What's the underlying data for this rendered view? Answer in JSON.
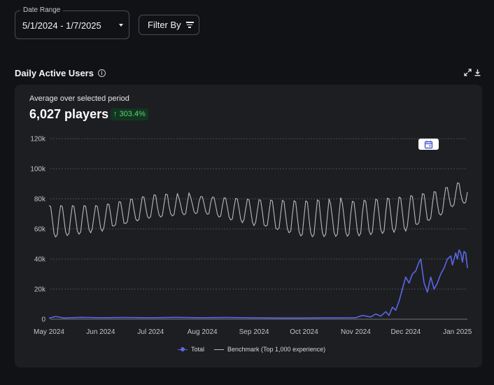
{
  "controls": {
    "date_range_label": "Date Range",
    "date_range_value": "5/1/2024 - 1/7/2025",
    "filter_label": "Filter By"
  },
  "section": {
    "title": "Daily Active Users",
    "info_glyph": "i"
  },
  "summary": {
    "label": "Average over selected period",
    "value": "6,027 players",
    "delta": "↑ 303.4%",
    "delta_color": "#5fd07a"
  },
  "icons": [
    "expand-icon",
    "download-icon",
    "info-icon",
    "calendar-icon",
    "filter-icon",
    "chevron-down-icon"
  ],
  "chart_data": {
    "type": "line",
    "x_tick_labels": [
      "May 2024",
      "Jun 2024",
      "Jul 2024",
      "Aug 2024",
      "Sep 2024",
      "Oct 2024",
      "Nov 2024",
      "Dec 2024",
      "Jan 2025"
    ],
    "x_range": [
      "2024-05-01",
      "2025-01-07"
    ],
    "ylim": [
      0,
      120000
    ],
    "y_ticks": [
      0,
      20000,
      40000,
      60000,
      80000,
      100000,
      120000
    ],
    "y_tick_labels": [
      "0",
      "20k",
      "40k",
      "60k",
      "80k",
      "100k",
      "120k"
    ],
    "grid": "horizontal dashed",
    "legend_position": "bottom-center",
    "series": [
      {
        "name": "Total",
        "color": "#5b67e8",
        "points": [
          [
            "2024-05-01",
            600
          ],
          [
            "2024-05-05",
            1800
          ],
          [
            "2024-05-10",
            800
          ],
          [
            "2024-05-20",
            1200
          ],
          [
            "2024-06-01",
            1000
          ],
          [
            "2024-06-15",
            1100
          ],
          [
            "2024-07-01",
            1000
          ],
          [
            "2024-07-15",
            1200
          ],
          [
            "2024-08-01",
            1000
          ],
          [
            "2024-08-15",
            1100
          ],
          [
            "2024-09-01",
            900
          ],
          [
            "2024-09-15",
            800
          ],
          [
            "2024-10-01",
            800
          ],
          [
            "2024-10-15",
            900
          ],
          [
            "2024-11-01",
            1000
          ],
          [
            "2024-11-05",
            2500
          ],
          [
            "2024-11-10",
            1500
          ],
          [
            "2024-11-13",
            3500
          ],
          [
            "2024-11-16",
            2000
          ],
          [
            "2024-11-19",
            5000
          ],
          [
            "2024-11-21",
            2500
          ],
          [
            "2024-11-23",
            8000
          ],
          [
            "2024-11-25",
            6000
          ],
          [
            "2024-11-27",
            12000
          ],
          [
            "2024-11-29",
            20000
          ],
          [
            "2024-12-01",
            28000
          ],
          [
            "2024-12-03",
            24000
          ],
          [
            "2024-12-05",
            30000
          ],
          [
            "2024-12-07",
            32000
          ],
          [
            "2024-12-09",
            38000
          ],
          [
            "2024-12-10",
            40000
          ],
          [
            "2024-12-12",
            24000
          ],
          [
            "2024-12-14",
            18000
          ],
          [
            "2024-12-16",
            28000
          ],
          [
            "2024-12-18",
            20000
          ],
          [
            "2024-12-20",
            24000
          ],
          [
            "2024-12-22",
            30000
          ],
          [
            "2024-12-24",
            34000
          ],
          [
            "2024-12-26",
            40000
          ],
          [
            "2024-12-28",
            42000
          ],
          [
            "2024-12-29",
            36000
          ],
          [
            "2024-12-31",
            44000
          ],
          [
            "2025-01-01",
            40000
          ],
          [
            "2025-01-02",
            46000
          ],
          [
            "2025-01-03",
            44000
          ],
          [
            "2025-01-04",
            38000
          ],
          [
            "2025-01-05",
            45000
          ],
          [
            "2025-01-06",
            44000
          ],
          [
            "2025-01-07",
            34000
          ]
        ]
      },
      {
        "name": "Benchmark (Top 1,000 experience)",
        "color": "#b8b9bd",
        "weekly_pattern_note_free": true,
        "weekly_peaks": [
          [
            "2024-05-01",
            77000
          ],
          [
            "2024-06-01",
            76000
          ],
          [
            "2024-07-01",
            82000
          ],
          [
            "2024-08-01",
            83000
          ],
          [
            "2024-09-01",
            80000
          ],
          [
            "2024-10-01",
            78000
          ],
          [
            "2024-11-01",
            80000
          ],
          [
            "2024-12-01",
            82000
          ],
          [
            "2024-12-20",
            85000
          ],
          [
            "2025-01-01",
            90000
          ],
          [
            "2025-01-07",
            90000
          ]
        ],
        "weekly_troughs": [
          [
            "2024-05-01",
            53000
          ],
          [
            "2024-06-01",
            58000
          ],
          [
            "2024-07-01",
            66000
          ],
          [
            "2024-08-01",
            70000
          ],
          [
            "2024-09-01",
            62000
          ],
          [
            "2024-10-01",
            53000
          ],
          [
            "2024-11-01",
            54000
          ],
          [
            "2024-12-01",
            58000
          ],
          [
            "2024-12-20",
            66000
          ],
          [
            "2025-01-01",
            76000
          ],
          [
            "2025-01-07",
            76000
          ]
        ]
      }
    ]
  }
}
